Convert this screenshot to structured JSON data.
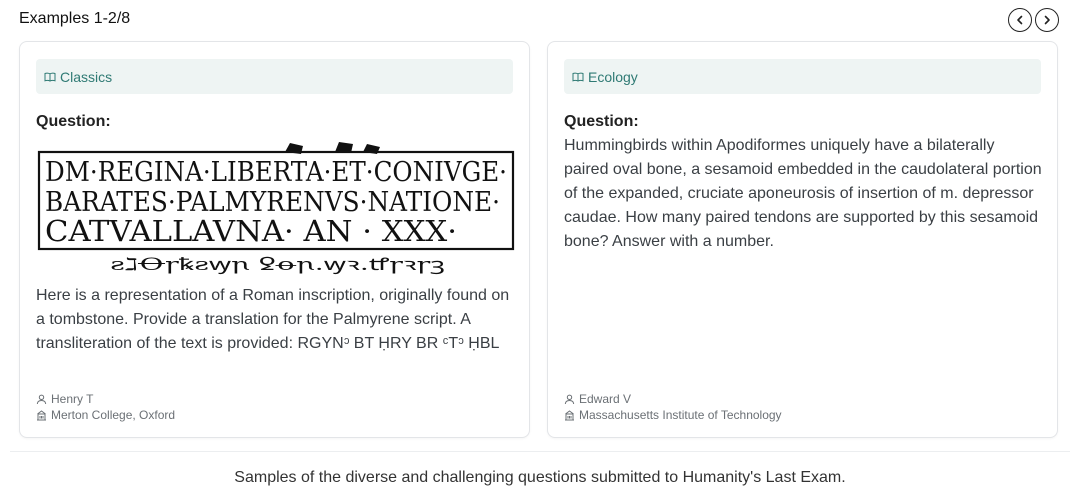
{
  "header": {
    "title": "Examples 1-2/8"
  },
  "nav": {
    "prev_icon": "chevron-left-icon",
    "next_icon": "chevron-right-icon"
  },
  "cards": [
    {
      "subject": "Classics",
      "question_label": "Question:",
      "question": "Here is a representation of a Roman inscription, originally found on a tombstone. Provide a translation for the Palmyrene script. A transliteration of the text is provided: RGYNᵓ BT ḤRY BR ᶜTᵓ ḤBL",
      "inscription_lines": [
        "DM·REGINA·LIBERTA·ET·CONIVGE·",
        "BARATES·PALMYRENVS·NATIONE·",
        "CATVALLAVNA· AN · XXX·"
      ],
      "palmyrene": "ꙅℷꝊꞅꝅꙅꝡꞃ ꝿꝋꞃ.ꝡꝛ.ꝷꞅꝛꞅꝫ",
      "author": "Henry T",
      "institution": "Merton College, Oxford"
    },
    {
      "subject": "Ecology",
      "question_label": "Question:",
      "question": "Hummingbirds within Apodiformes uniquely have a bilaterally paired oval bone, a sesamoid embedded in the caudolateral portion of the expanded, cruciate aponeurosis of insertion of m. depressor caudae. How many paired tendons are supported by this sesamoid bone? Answer with a number.",
      "author": "Edward V",
      "institution": "Massachusetts Institute of Technology"
    }
  ],
  "caption": "Samples of the diverse and challenging questions submitted to Humanity's Last Exam.",
  "colors": {
    "accent": "#2f7a74",
    "subject_bg": "#eef4f3",
    "border": "#e3e5e8"
  }
}
